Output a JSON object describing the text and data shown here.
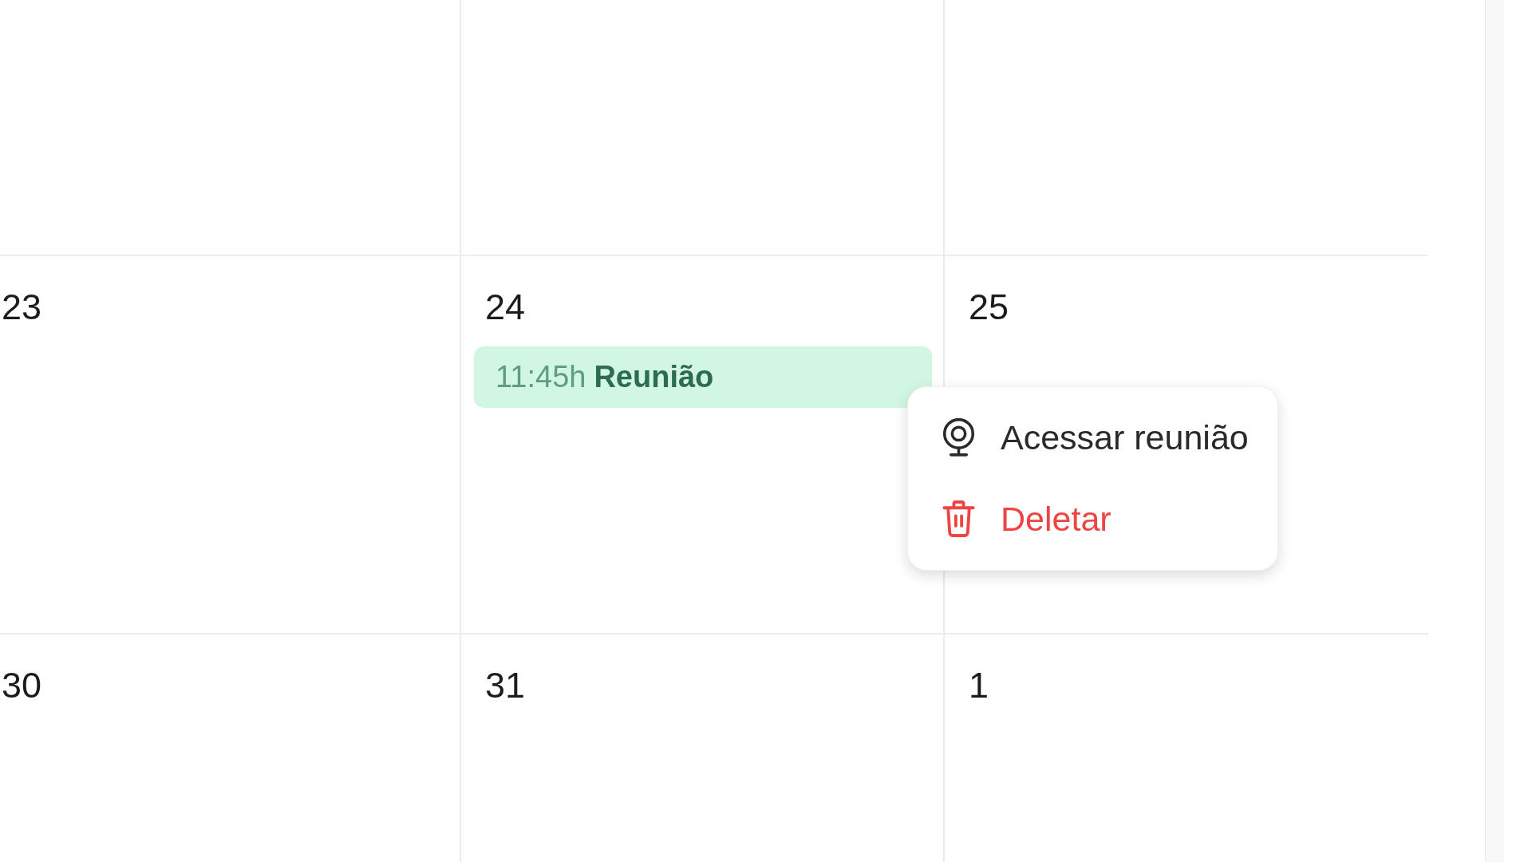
{
  "calendar": {
    "weeks": [
      {
        "days": [
          {
            "date": "23"
          },
          {
            "date": "24",
            "events": [
              {
                "time": "11:45h",
                "title": "Reunião",
                "color": "#d1f7e4"
              }
            ]
          },
          {
            "date": "25"
          }
        ]
      },
      {
        "days": [
          {
            "date": "30"
          },
          {
            "date": "31"
          },
          {
            "date": "1"
          }
        ]
      }
    ]
  },
  "context_menu": {
    "items": [
      {
        "label": "Acessar reunião",
        "kind": "default"
      },
      {
        "label": "Deletar",
        "kind": "danger"
      }
    ]
  }
}
